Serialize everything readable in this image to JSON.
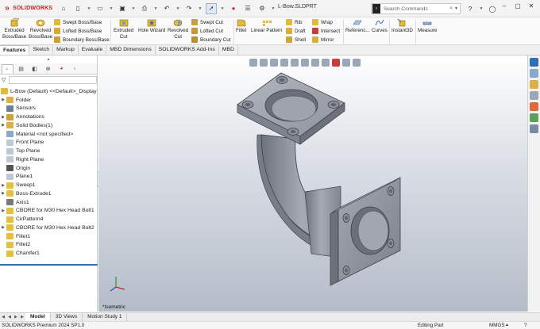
{
  "app": {
    "logo": "SOLIDWORKS",
    "document_title": "L-Bow.SLDPRT",
    "search_placeholder": "Search Commands"
  },
  "ribbon": {
    "extruded_boss": [
      "Extruded",
      "Boss/Base"
    ],
    "revolved_boss": [
      "Revolved",
      "Boss/Base"
    ],
    "swept_boss": "Swept Boss/Base",
    "lofted_boss": "Lofted Boss/Base",
    "boundary_boss": "Boundary Boss/Base",
    "extruded_cut": [
      "Extruded",
      "Cut"
    ],
    "hole_wizard": "Hole Wizard",
    "revolved_cut": [
      "Revolved",
      "Cut"
    ],
    "swept_cut": "Swept Cut",
    "lofted_cut": "Lofted Cut",
    "boundary_cut": "Boundary Cut",
    "fillet": "Fillet",
    "linear_pattern": "Linear Pattern",
    "rib": "Rib",
    "draft": "Draft",
    "shell": "Shell",
    "wrap": "Wrap",
    "intersect": "Intersect",
    "mirror": "Mirror",
    "reference": "Referenc...",
    "curves": "Curves",
    "instant3d": "Instant3D",
    "measure": "Measure"
  },
  "tabs": [
    "Features",
    "Sketch",
    "Markup",
    "Evaluate",
    "MBD Dimensions",
    "SOLIDWORKS Add-Ins",
    "MBD"
  ],
  "active_tab": "Features",
  "tree": {
    "root": "L-Bow (Default) <<Default>_Display",
    "items": [
      {
        "label": "Folder",
        "expand": true,
        "icon_color": "#e0b040"
      },
      {
        "label": "Sensors",
        "expand": false,
        "icon_color": "#6a7f99"
      },
      {
        "label": "Annotations",
        "expand": true,
        "icon_color": "#c9a340"
      },
      {
        "label": "Solid Bodies(1)",
        "expand": true,
        "icon_color": "#d9b24a"
      },
      {
        "label": "Material <not specified>",
        "expand": false,
        "icon_color": "#8aa9c9"
      },
      {
        "label": "Front Plane",
        "expand": false,
        "icon_color": "#bfc9d6"
      },
      {
        "label": "Top Plane",
        "expand": false,
        "icon_color": "#bfc9d6"
      },
      {
        "label": "Right Plane",
        "expand": false,
        "icon_color": "#bfc9d6"
      },
      {
        "label": "Origin",
        "expand": false,
        "icon_color": "#555555"
      },
      {
        "label": "Plane1",
        "expand": false,
        "icon_color": "#bfc9d6"
      },
      {
        "label": "Sweep1",
        "expand": true,
        "icon_color": "#e4c041"
      },
      {
        "label": "Boss-Extrude1",
        "expand": true,
        "icon_color": "#e4c041"
      },
      {
        "label": "Axis1",
        "expand": false,
        "icon_color": "#7a7a7a"
      },
      {
        "label": "CBORE for M30 Hex Head Bolt1",
        "expand": true,
        "icon_color": "#e4c041"
      },
      {
        "label": "CirPattern4",
        "expand": false,
        "icon_color": "#e4c041"
      },
      {
        "label": "CBORE for M30 Hex Head Bolt2",
        "expand": true,
        "icon_color": "#e4c041"
      },
      {
        "label": "Fillet1",
        "expand": false,
        "icon_color": "#e4c041"
      },
      {
        "label": "Fillet2",
        "expand": false,
        "icon_color": "#e4c041"
      },
      {
        "label": "Chamfer1",
        "expand": false,
        "icon_color": "#e4c041"
      }
    ]
  },
  "viewport": {
    "view_name": "*Isometric"
  },
  "bottom_tabs": [
    "Model",
    "3D Views",
    "Motion Study 1"
  ],
  "active_bottom_tab": "Model",
  "status": {
    "product": "SOLIDWORKS Premium 2024 SP1.0",
    "mode": "Editing Part",
    "units": "MMGS"
  },
  "colors": {
    "brand_red": "#d71920",
    "model_gray": "#8c919d",
    "accent_blue": "#2f6fb6"
  }
}
